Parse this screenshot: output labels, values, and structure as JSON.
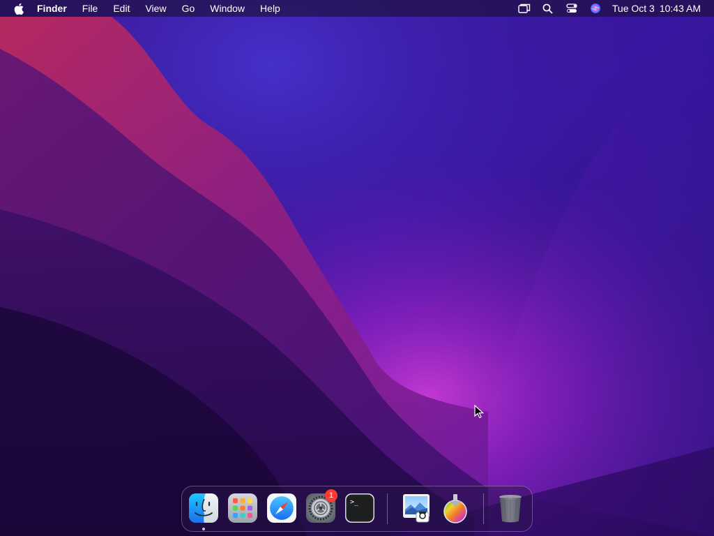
{
  "menubar": {
    "apple_icon": "apple-logo-icon",
    "app_name": "Finder",
    "menus": [
      "File",
      "Edit",
      "View",
      "Go",
      "Window",
      "Help"
    ],
    "status_icons": [
      "screen-mirroring-icon",
      "search-icon",
      "control-center-icon",
      "siri-icon"
    ],
    "clock": {
      "date": "Tue Oct 3",
      "time": "10:43 AM"
    }
  },
  "dock": {
    "apps": [
      {
        "id": "finder",
        "icon": "finder-icon",
        "running": true
      },
      {
        "id": "launchpad",
        "icon": "launchpad-icon",
        "running": false
      },
      {
        "id": "safari",
        "icon": "safari-icon",
        "running": false
      },
      {
        "id": "system-settings",
        "icon": "gear-icon",
        "running": false,
        "badge": "1"
      },
      {
        "id": "terminal",
        "icon": "terminal-icon",
        "running": false,
        "glyph": ">_"
      },
      {
        "id": "preview",
        "icon": "preview-icon",
        "running": false
      },
      {
        "id": "installer",
        "icon": "installer-icon",
        "running": false
      },
      {
        "id": "trash",
        "icon": "trash-icon",
        "running": false
      }
    ]
  },
  "colors": {
    "wallpaper_base": "#3a1578",
    "wallpaper_glow": "#b32ec8",
    "wallpaper_red": "#c22a5a",
    "badge": "#ff3b30",
    "finder_blue": "#1e8cf0"
  }
}
